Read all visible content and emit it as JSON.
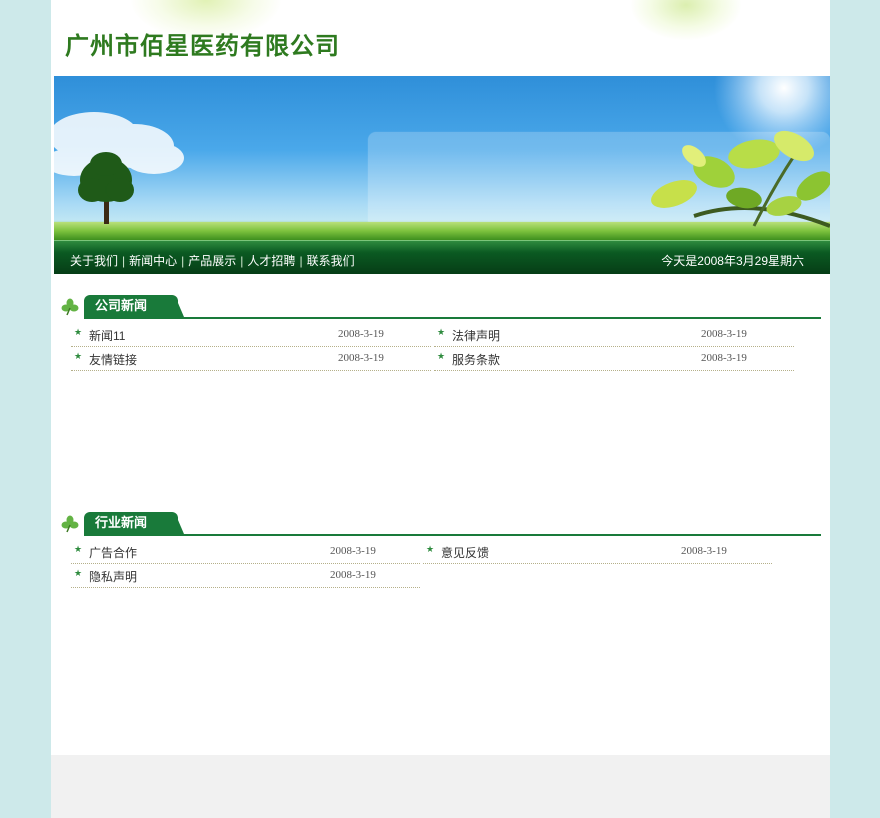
{
  "header": {
    "company_name": "广州市佰星医药有限公司"
  },
  "nav": {
    "items": [
      "关于我们",
      "新闻中心",
      "产品展示",
      "人才招聘",
      "联系我们"
    ],
    "separator": "|",
    "date_text": "今天是2008年3月29星期六"
  },
  "company_news": {
    "title": "公司新闻",
    "items": [
      {
        "title": "新闻11",
        "date": "2008-3-19"
      },
      {
        "title": "法律声明",
        "date": "2008-3-19"
      },
      {
        "title": "友情链接",
        "date": "2008-3-19"
      },
      {
        "title": "服务条款",
        "date": "2008-3-19"
      }
    ]
  },
  "industry_news": {
    "title": "行业新闻",
    "items": [
      {
        "title": "广告合作",
        "date": "2008-3-19"
      },
      {
        "title": "意见反馈",
        "date": "2008-3-19"
      },
      {
        "title": "隐私声明",
        "date": "2008-3-19"
      }
    ]
  },
  "icons": {
    "bullet": "star-icon",
    "section": "clover-icon"
  },
  "colors": {
    "brand_green": "#197a3a",
    "logo_green": "#2e7a1f",
    "page_bg": "#cde9ea"
  }
}
